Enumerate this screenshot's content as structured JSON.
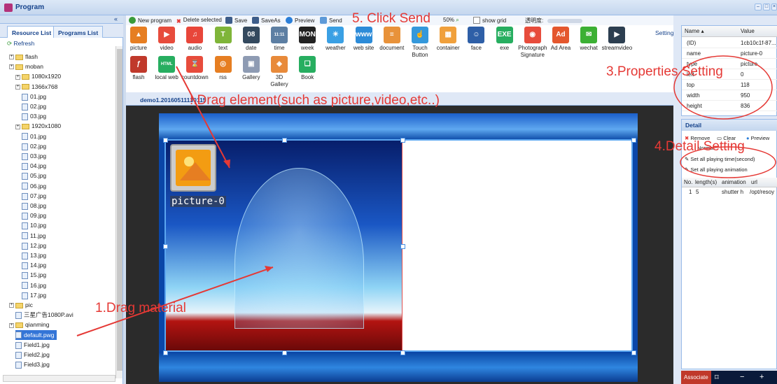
{
  "window": {
    "title": "Program"
  },
  "left": {
    "tabs": [
      "Resource List",
      "Programs List"
    ],
    "refresh": "Refresh",
    "tree": [
      {
        "label": "flash",
        "type": "folder",
        "indent": 1
      },
      {
        "label": "moban",
        "type": "folder",
        "indent": 1
      },
      {
        "label": "1080x1920",
        "type": "folder",
        "indent": 2
      },
      {
        "label": "1366x768",
        "type": "folder",
        "indent": 2
      },
      {
        "label": "01.jpg",
        "type": "file",
        "indent": 3
      },
      {
        "label": "02.jpg",
        "type": "file",
        "indent": 3
      },
      {
        "label": "03.jpg",
        "type": "file",
        "indent": 3
      },
      {
        "label": "1920x1080",
        "type": "folder",
        "indent": 2
      },
      {
        "label": "01.jpg",
        "type": "file",
        "indent": 3
      },
      {
        "label": "02.jpg",
        "type": "file",
        "indent": 3
      },
      {
        "label": "03.jpg",
        "type": "file",
        "indent": 3
      },
      {
        "label": "04.jpg",
        "type": "file",
        "indent": 3
      },
      {
        "label": "05.jpg",
        "type": "file",
        "indent": 3
      },
      {
        "label": "06.jpg",
        "type": "file",
        "indent": 3
      },
      {
        "label": "07.jpg",
        "type": "file",
        "indent": 3
      },
      {
        "label": "08.jpg",
        "type": "file",
        "indent": 3
      },
      {
        "label": "09.jpg",
        "type": "file",
        "indent": 3
      },
      {
        "label": "10.jpg",
        "type": "file",
        "indent": 3
      },
      {
        "label": "11.jpg",
        "type": "file",
        "indent": 3
      },
      {
        "label": "12.jpg",
        "type": "file",
        "indent": 3
      },
      {
        "label": "13.jpg",
        "type": "file",
        "indent": 3
      },
      {
        "label": "14.jpg",
        "type": "file",
        "indent": 3
      },
      {
        "label": "15.jpg",
        "type": "file",
        "indent": 3
      },
      {
        "label": "16.jpg",
        "type": "file",
        "indent": 3
      },
      {
        "label": "17.jpg",
        "type": "file",
        "indent": 3
      },
      {
        "label": "pic",
        "type": "folder",
        "indent": 1
      },
      {
        "label": "三星广告1080P.avi",
        "type": "file",
        "indent": 2
      },
      {
        "label": "qianming",
        "type": "folder",
        "indent": 1
      },
      {
        "label": "default.pwg",
        "type": "file",
        "indent": 2,
        "selected": true
      },
      {
        "label": "Field1.jpg",
        "type": "file",
        "indent": 2
      },
      {
        "label": "Field2.jpg",
        "type": "file",
        "indent": 2
      },
      {
        "label": "Field3.jpg",
        "type": "file",
        "indent": 2
      }
    ]
  },
  "toolbar": {
    "new_program": "New program",
    "delete": "Delete selected",
    "save": "Save",
    "saveas": "SaveAs",
    "preview": "Preview",
    "send": "Send",
    "zoom": "50%",
    "show_grid": "show grid",
    "opacity": "透明度:"
  },
  "palette": {
    "row1": [
      {
        "label": "picture",
        "icon": "picture-icon",
        "color": "#e67e22",
        "glyph": "▲"
      },
      {
        "label": "video",
        "icon": "video-icon",
        "color": "#e74c3c",
        "glyph": "▶"
      },
      {
        "label": "audio",
        "icon": "audio-icon",
        "color": "#e8463a",
        "glyph": "♫"
      },
      {
        "label": "text",
        "icon": "text-icon",
        "color": "#7fb539",
        "glyph": "T"
      },
      {
        "label": "date",
        "icon": "date-icon",
        "color": "#34495e",
        "glyph": "08"
      },
      {
        "label": "time",
        "icon": "time-icon",
        "color": "#5d7fa3",
        "glyph": "11:11"
      },
      {
        "label": "week",
        "icon": "week-icon",
        "color": "#222222",
        "glyph": "MON"
      },
      {
        "label": "weather",
        "icon": "weather-icon",
        "color": "#3aa0e4",
        "glyph": "☀"
      },
      {
        "label": "web site",
        "icon": "website-icon",
        "color": "#2c8bd8",
        "glyph": "www"
      },
      {
        "label": "document",
        "icon": "document-icon",
        "color": "#e8923a",
        "glyph": "≡"
      },
      {
        "label": "Touch\nButton",
        "icon": "touch-button-icon",
        "color": "#3498db",
        "glyph": "☝"
      },
      {
        "label": "container",
        "icon": "container-icon",
        "color": "#f0a03c",
        "glyph": "▦"
      },
      {
        "label": "face",
        "icon": "face-icon",
        "color": "#2e5fa7",
        "glyph": "☺"
      },
      {
        "label": "exe",
        "icon": "exe-icon",
        "color": "#27ae60",
        "glyph": "EXE"
      },
      {
        "label": "Photograph\nSignature",
        "icon": "camera-icon",
        "color": "#e74c3c",
        "glyph": "◉"
      },
      {
        "label": "Ad Area",
        "icon": "ad-icon",
        "color": "#e4572e",
        "glyph": "Ad"
      },
      {
        "label": "wechat",
        "icon": "wechat-icon",
        "color": "#3cb034",
        "glyph": "✉"
      },
      {
        "label": "streamvideo",
        "icon": "clapper-icon",
        "color": "#2c3e50",
        "glyph": "▶"
      }
    ],
    "row2": [
      {
        "label": "flash",
        "icon": "flash-icon",
        "color": "#c0392b",
        "glyph": "ƒ"
      },
      {
        "label": "local web",
        "icon": "html-icon",
        "color": "#27ae60",
        "glyph": "HTML"
      },
      {
        "label": "countdown",
        "icon": "hourglass-icon",
        "color": "#e74c3c",
        "glyph": "⌛"
      },
      {
        "label": "rss",
        "icon": "rss-icon",
        "color": "#e67e22",
        "glyph": "◎"
      },
      {
        "label": "Gallery",
        "icon": "gallery-icon",
        "color": "#8e9bb3",
        "glyph": "▣"
      },
      {
        "label": "3D\nGallery",
        "icon": "gallery3d-icon",
        "color": "#e88a3a",
        "glyph": "◈"
      },
      {
        "label": "Book",
        "icon": "book-icon",
        "color": "#27ae60",
        "glyph": "❑"
      }
    ]
  },
  "doc_tab": "demo1.20160511130115",
  "element_label": "picture-0",
  "setting_label": "Setting",
  "props": {
    "col_name": "Name ▴",
    "col_value": "Value",
    "rows": [
      {
        "k": "(ID)",
        "v": "1cb10c1f-87..."
      },
      {
        "k": "name",
        "v": "picture-0"
      },
      {
        "k": "type",
        "v": "picture"
      },
      {
        "k": "left",
        "v": "0"
      },
      {
        "k": "top",
        "v": "118"
      },
      {
        "k": "width",
        "v": "950"
      },
      {
        "k": "height",
        "v": "836"
      }
    ]
  },
  "detail": {
    "title": "Detail",
    "remove": "Remove",
    "clear": "Clear",
    "preview": "Preview",
    "normal": "Normal",
    "set_time": "Set all playing time(second)",
    "set_anim": "Set all playing animation",
    "cols": [
      "No.",
      "length(s)",
      "animation",
      "url"
    ],
    "row": {
      "no": "1",
      "len": "5",
      "anim": "shutter h",
      "url": "/opt/resoy"
    }
  },
  "associate": "Associate",
  "annotations": {
    "drag_material": "1.Drag material",
    "drag_element": "!.Drag element(such as picture,video,etc..)",
    "properties": "3.Properties Setting",
    "detail": "4.Detail Setting",
    "send": "5. Click Send"
  },
  "colors": {
    "annotation": "#e53935",
    "accent": "#15428b"
  }
}
